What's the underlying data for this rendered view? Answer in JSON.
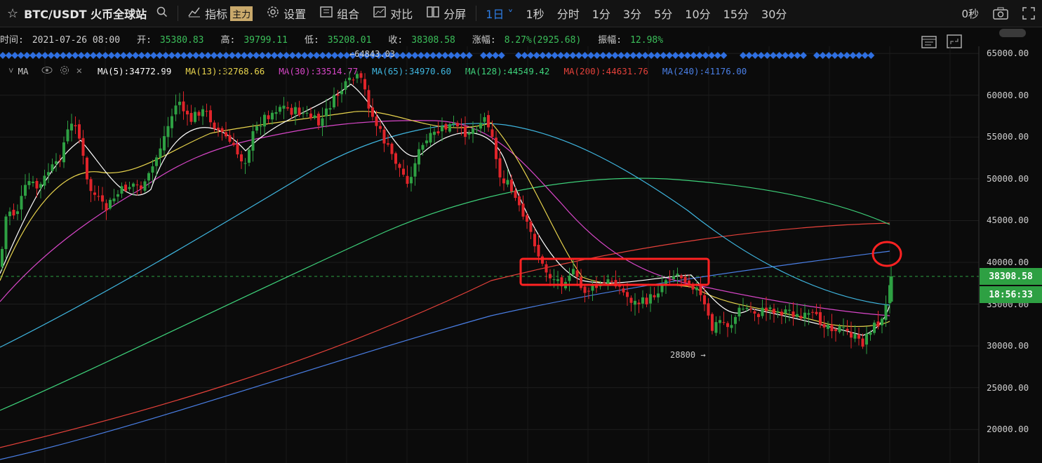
{
  "toolbar": {
    "symbol": "BTC/USDT 火币全球站",
    "indicator_label": "指标",
    "indicator_badge": "主力",
    "settings_label": "设置",
    "combo_label": "组合",
    "compare_label": "对比",
    "split_label": "分屏",
    "timeframes": [
      "1日",
      "1秒",
      "分时",
      "1分",
      "3分",
      "5分",
      "10分",
      "15分",
      "30分"
    ],
    "active_timeframe": "1日",
    "countdown_short": "0秒"
  },
  "info": {
    "time_label": "时间:",
    "time": "2021-07-26 08:00",
    "open_label": "开:",
    "open": "35380.83",
    "high_label": "高:",
    "high": "39799.11",
    "low_label": "低:",
    "low": "35208.01",
    "close_label": "收:",
    "close": "38308.58",
    "change_label": "涨幅:",
    "change": "8.27%(2925.68)",
    "amp_label": "振幅:",
    "amp": "12.98%"
  },
  "ma_bar": {
    "title": "MA",
    "items": [
      {
        "label": "MA(5):34772.99",
        "color": "#ffffff"
      },
      {
        "label": "MA(13):32768.66",
        "color": "#e8d44d"
      },
      {
        "label": "MA(30):33514.77",
        "color": "#d846c8"
      },
      {
        "label": "MA(65):34970.60",
        "color": "#3fb6e0"
      },
      {
        "label": "MA(128):44549.42",
        "color": "#3ed37b"
      },
      {
        "label": "MA(200):44631.76",
        "color": "#e5413a"
      },
      {
        "label": "MA(240):41176.00",
        "color": "#4a7fe6"
      }
    ]
  },
  "price_axis": [
    "65000.00",
    "60000.00",
    "55000.00",
    "50000.00",
    "45000.00",
    "40000.00",
    "35000.00",
    "30000.00",
    "25000.00",
    "20000.00"
  ],
  "current_price": "38308.58",
  "countdown": "18:56:33",
  "annotations": {
    "high_marker": "64843.03",
    "low_marker": "28800 →"
  },
  "colors": {
    "up": "#2ea043",
    "down": "#e0242a",
    "accent": "#2e7ee6",
    "diamond": "#2f6fe0"
  }
}
